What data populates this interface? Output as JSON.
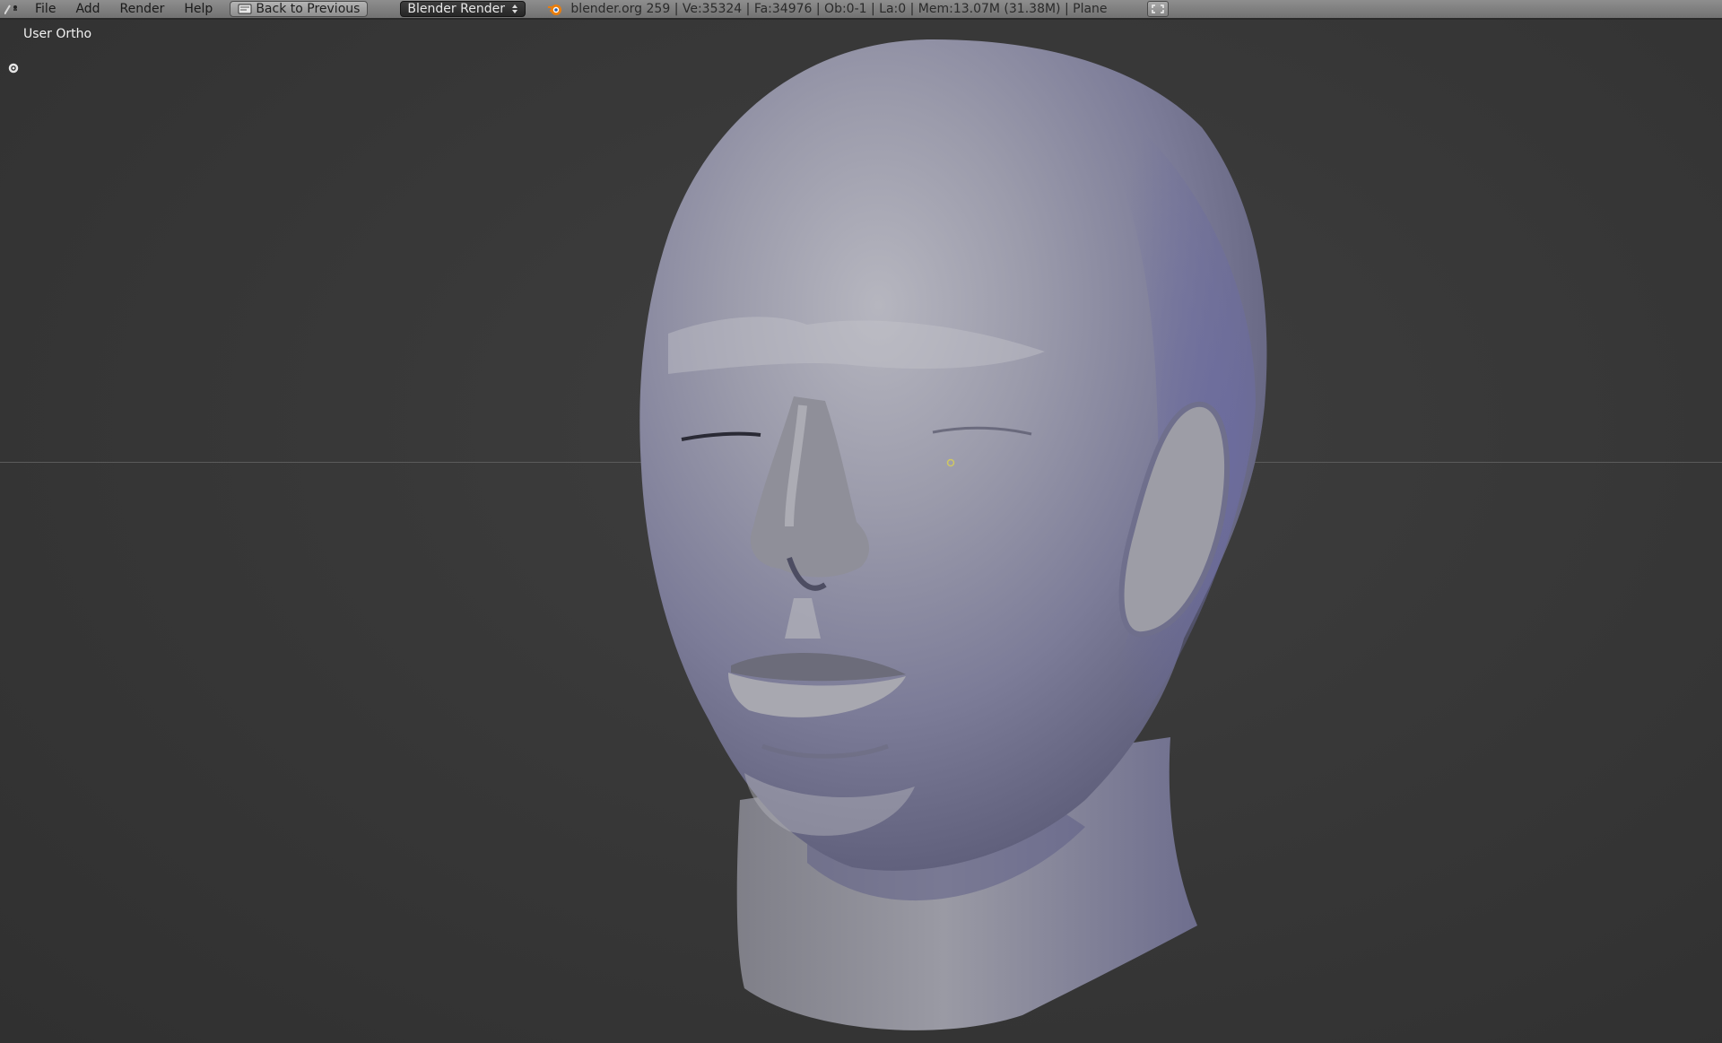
{
  "app": "Blender",
  "menu": {
    "items": [
      "File",
      "Add",
      "Render",
      "Help"
    ]
  },
  "toolbar": {
    "back_label": "Back to Previous",
    "render_engine": "Blender Render",
    "stats": "blender.org 259 | Ve:35324 | Fa:34976 | Ob:0-1 | La:0 | Mem:13.07M (31.38M) | Plane"
  },
  "viewport": {
    "view_label": "User Ortho"
  },
  "icons": {
    "editor_type": "editor-type-icon",
    "back": "back-icon",
    "engine_arrows": "updown-arrows-icon",
    "logo": "blender-logo-icon",
    "fullscreen": "fullscreen-icon",
    "settings": "gear-icon"
  },
  "colors": {
    "topbar": "#808080",
    "viewport_bg": "#393939",
    "model_base": "#8e8ea4",
    "engine_select_bg": "#2f2f2f"
  }
}
